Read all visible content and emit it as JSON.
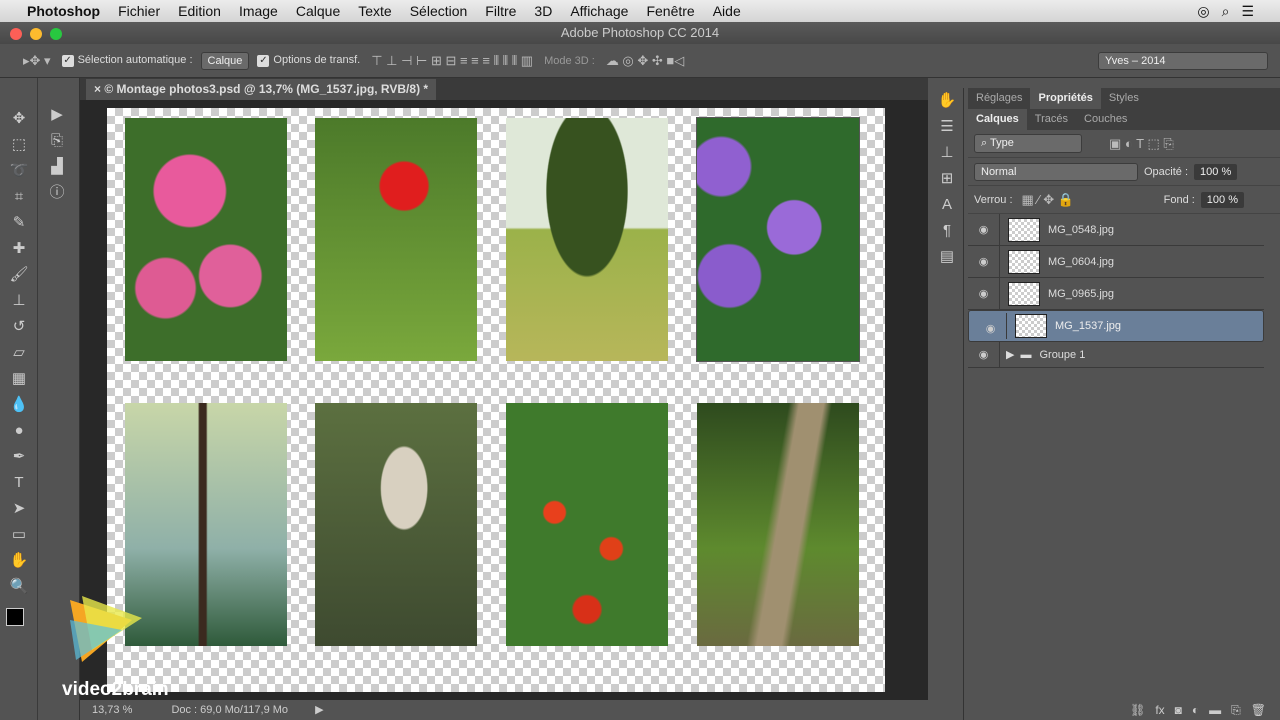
{
  "menu": {
    "apple": "",
    "app": "Photoshop",
    "items": [
      "Fichier",
      "Edition",
      "Image",
      "Calque",
      "Texte",
      "Sélection",
      "Filtre",
      "3D",
      "Affichage",
      "Fenêtre",
      "Aide"
    ]
  },
  "window_title": "Adobe Photoshop CC 2014",
  "options": {
    "auto_select_label": "Sélection automatique :",
    "auto_select_value": "Calque",
    "transform_label": "Options de transf.",
    "mode3d_label": "Mode 3D :",
    "workspace": "Yves – 2014"
  },
  "document_tab": "© Montage photos3.psd @ 13,7% (MG_1537.jpg, RVB/8) *",
  "status": {
    "zoom": "13,73 %",
    "doc": "Doc : 69,0 Mo/117,9 Mo"
  },
  "panels": {
    "top_tabs": [
      "Réglages",
      "Propriétés",
      "Styles"
    ],
    "layer_tabs": [
      "Calques",
      "Tracés",
      "Couches"
    ],
    "filter": "Type",
    "blend_mode": "Normal",
    "opacity_label": "Opacité :",
    "opacity": "100 %",
    "lock_label": "Verrou :",
    "fill_label": "Fond :",
    "fill": "100 %"
  },
  "layers": [
    {
      "name": "MG_0548.jpg",
      "selected": false
    },
    {
      "name": "MG_0604.jpg",
      "selected": false
    },
    {
      "name": "MG_0965.jpg",
      "selected": false
    },
    {
      "name": "MG_1537.jpg",
      "selected": true
    }
  ],
  "group": "Groupe 1",
  "watermark": "video2brain"
}
